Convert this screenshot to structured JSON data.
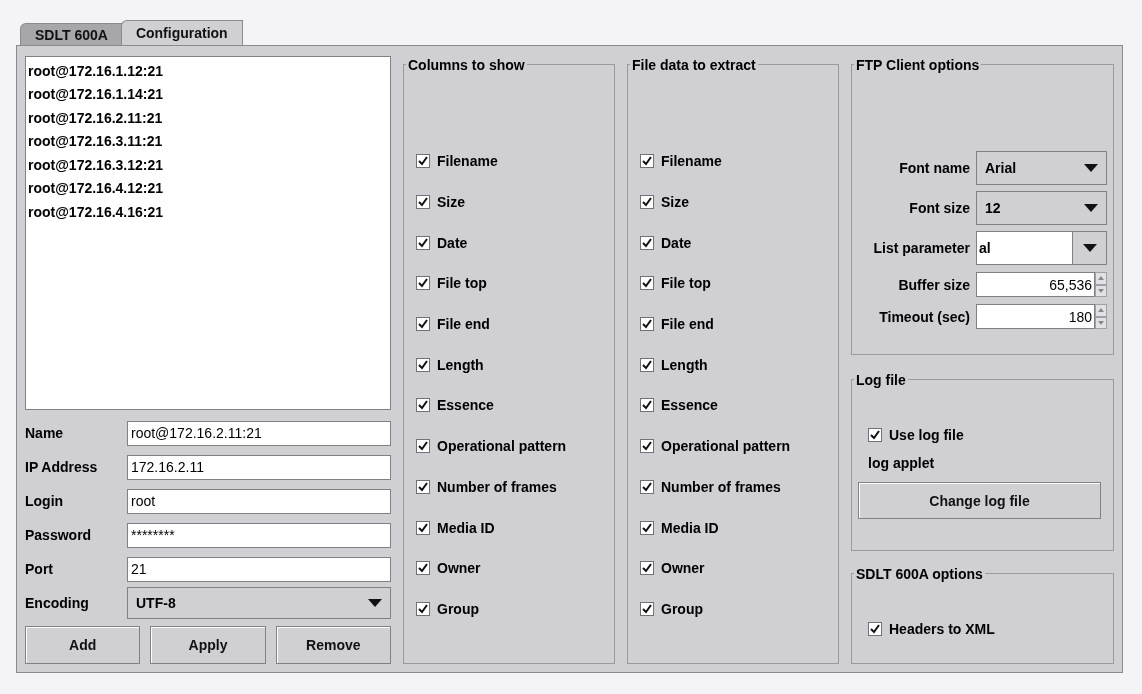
{
  "tabs": [
    {
      "label": "SDLT 600A",
      "selected": false
    },
    {
      "label": "Configuration",
      "selected": true
    }
  ],
  "hosts": [
    {
      "label": "root@172.16.1.12:21",
      "selected": false
    },
    {
      "label": "root@172.16.1.14:21",
      "selected": false
    },
    {
      "label": "root@172.16.2.11:21",
      "selected": false
    },
    {
      "label": "root@172.16.3.11:21",
      "selected": false
    },
    {
      "label": "root@172.16.3.12:21",
      "selected": false
    },
    {
      "label": "root@172.16.4.12:21",
      "selected": false
    },
    {
      "label": "root@172.16.4.16:21",
      "selected": false
    }
  ],
  "host_form": [
    {
      "label": "Name",
      "kind": "text",
      "value": "root@172.16.2.11:21"
    },
    {
      "label": "IP Address",
      "kind": "text",
      "value": "172.16.2.11"
    },
    {
      "label": "Login",
      "kind": "text",
      "value": "root"
    },
    {
      "label": "Password",
      "kind": "text",
      "value": "********"
    },
    {
      "label": "Port",
      "kind": "text",
      "value": "21"
    },
    {
      "label": "Encoding",
      "kind": "select",
      "value": "UTF-8"
    }
  ],
  "host_buttons": [
    "Add",
    "Apply",
    "Remove"
  ],
  "column_groups": [
    {
      "title": "Columns to show",
      "items": [
        {
          "label": "Filename",
          "checked": true
        },
        {
          "label": "Size",
          "checked": true
        },
        {
          "label": "Date",
          "checked": true
        },
        {
          "label": "File top",
          "checked": true
        },
        {
          "label": "File end",
          "checked": true
        },
        {
          "label": "Length",
          "checked": true
        },
        {
          "label": "Essence",
          "checked": true
        },
        {
          "label": "Operational pattern",
          "checked": true
        },
        {
          "label": "Number of frames",
          "checked": true
        },
        {
          "label": "Media ID",
          "checked": true
        },
        {
          "label": "Owner",
          "checked": true
        },
        {
          "label": "Group",
          "checked": true
        }
      ]
    },
    {
      "title": "File data to extract",
      "items": [
        {
          "label": "Filename",
          "checked": true
        },
        {
          "label": "Size",
          "checked": true
        },
        {
          "label": "Date",
          "checked": true
        },
        {
          "label": "File top",
          "checked": true
        },
        {
          "label": "File end",
          "checked": true
        },
        {
          "label": "Length",
          "checked": true
        },
        {
          "label": "Essence",
          "checked": true
        },
        {
          "label": "Operational pattern",
          "checked": true
        },
        {
          "label": "Number of frames",
          "checked": true
        },
        {
          "label": "Media ID",
          "checked": true
        },
        {
          "label": "Owner",
          "checked": true
        },
        {
          "label": "Group",
          "checked": true
        }
      ]
    }
  ],
  "ftp_options": {
    "title": "FTP Client options",
    "fields": [
      {
        "label": "Font name",
        "kind": "select",
        "value": "Arial"
      },
      {
        "label": "Font size",
        "kind": "select",
        "value": "12"
      },
      {
        "label": "List parameter",
        "kind": "combo",
        "value": "al"
      },
      {
        "label": "Buffer size",
        "kind": "spinner",
        "value": "65,536"
      },
      {
        "label": "Timeout (sec)",
        "kind": "spinner",
        "value": "180"
      }
    ]
  },
  "log_file": {
    "title": "Log file",
    "use_log_file": {
      "label": "Use log file",
      "checked": true
    },
    "path_label": "log applet",
    "button": "Change log file"
  },
  "sdlt_options": {
    "title": "SDLT 600A options",
    "headers_to_xml": {
      "label": "Headers to XML",
      "checked": true
    }
  }
}
